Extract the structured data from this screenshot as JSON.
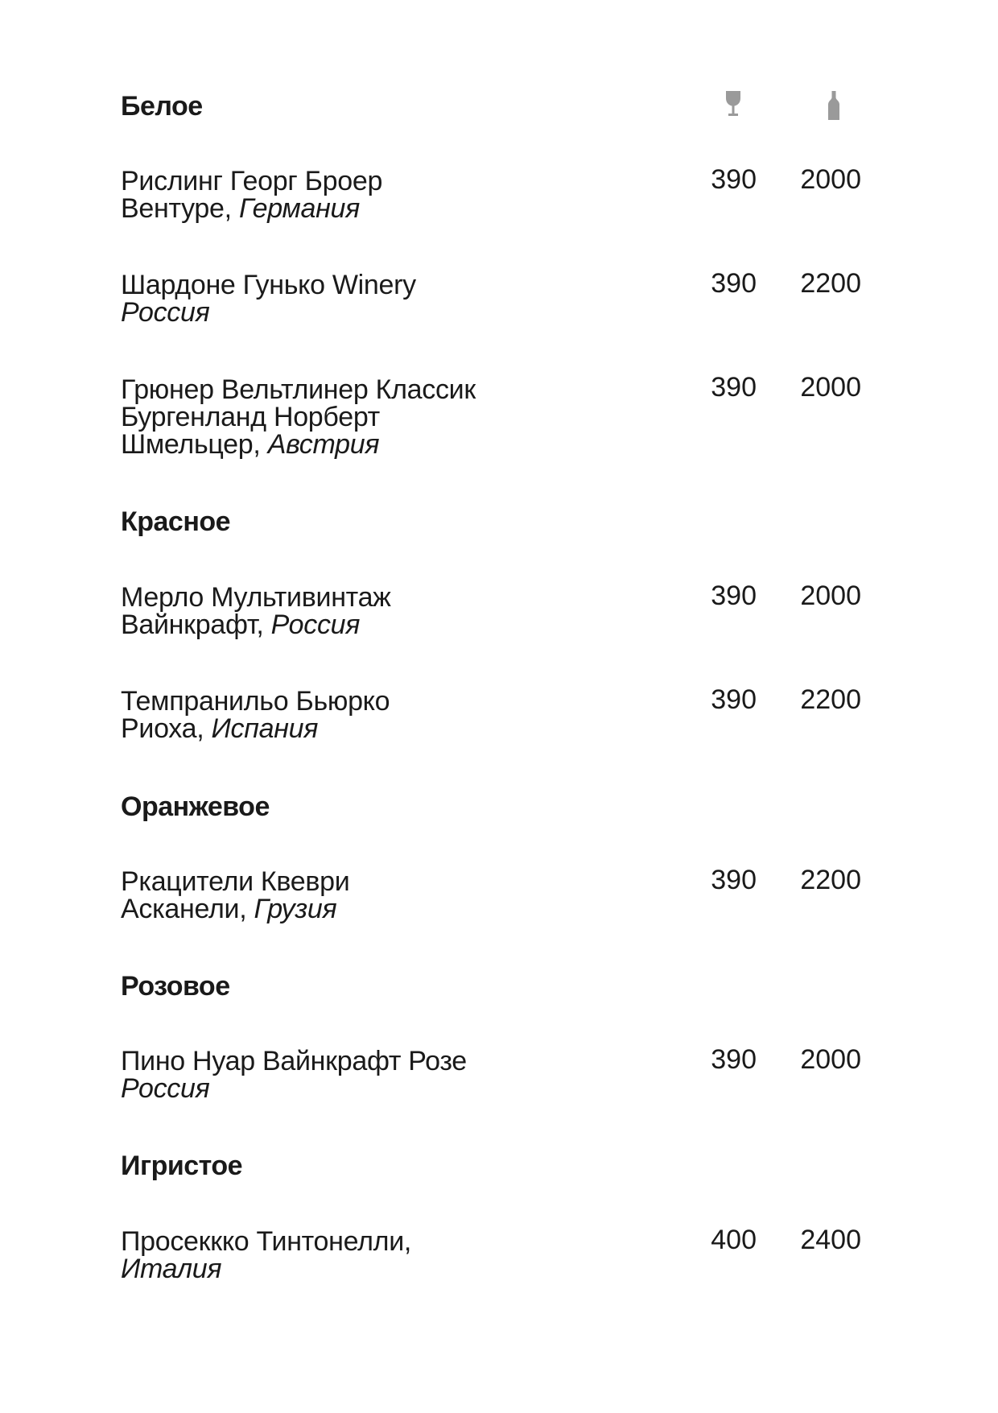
{
  "header": {
    "glass_icon": "wine-glass-icon",
    "bottle_icon": "wine-bottle-icon",
    "icon_color": "#9a9a9a"
  },
  "sections": [
    {
      "title": "Белое",
      "items": [
        {
          "name_lines": [
            "Рислинг Георг Броер",
            "Вентуре, "
          ],
          "country": "Германия",
          "glass": "390",
          "bottle": "2000"
        },
        {
          "name_lines": [
            "Шардоне Гунько Winery",
            ""
          ],
          "country": "Россия",
          "glass": "390",
          "bottle": "2200"
        },
        {
          "name_lines": [
            "Грюнер Вельтлинер Классик",
            "Бургенланд Норберт",
            "Шмельцер, "
          ],
          "country": "Австрия",
          "glass": "390",
          "bottle": "2000"
        }
      ]
    },
    {
      "title": "Красное",
      "items": [
        {
          "name_lines": [
            "Мерло Мультивинтаж",
            "Вайнкрафт, "
          ],
          "country": "Россия",
          "glass": "390",
          "bottle": "2000"
        },
        {
          "name_lines": [
            "Темпранильо Бьюрко",
            "Риоха, "
          ],
          "country": "Испания",
          "glass": "390",
          "bottle": "2200"
        }
      ]
    },
    {
      "title": "Оранжевое",
      "items": [
        {
          "name_lines": [
            "Ркацители Квеври",
            "Асканели, "
          ],
          "country": "Грузия",
          "glass": "390",
          "bottle": "2200"
        }
      ]
    },
    {
      "title": "Розовое",
      "items": [
        {
          "name_lines": [
            "Пино Нуар Вайнкрафт Розе",
            ""
          ],
          "country": "Россия",
          "glass": "390",
          "bottle": "2000"
        }
      ]
    },
    {
      "title": "Игристое",
      "items": [
        {
          "name_lines": [
            "Просеккко Тинтонелли,",
            ""
          ],
          "country": "Италия",
          "glass": "400",
          "bottle": "2400"
        }
      ]
    }
  ]
}
